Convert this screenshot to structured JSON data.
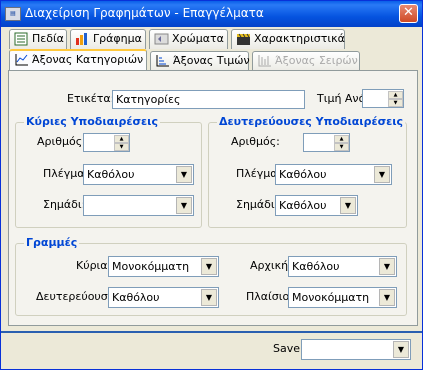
{
  "window": {
    "title": "Διαχείριση Γραφημάτων - Επαγγέλματα",
    "close_glyph": "✕"
  },
  "main_tabs": [
    {
      "label": "Πεδία",
      "icon": "fields-icon"
    },
    {
      "label": "Γράφημα",
      "icon": "bar-chart-icon"
    },
    {
      "label": "Χρώματα",
      "icon": "colors-icon"
    },
    {
      "label": "Χαρακτηριστικά",
      "icon": "clapperboard-icon"
    }
  ],
  "sub_tabs": [
    {
      "label": "Άξονας Κατηγοριών",
      "icon": "axis-icon",
      "selected": true
    },
    {
      "label": "Άξονας Τιμών",
      "icon": "axis-icon"
    },
    {
      "label": "Άξονας Σειρών",
      "icon": "axis-icon",
      "disabled": true
    }
  ],
  "caption": {
    "label": "Ετικέτα:",
    "value": "Κατηγορίες"
  },
  "value_step": {
    "label": "Τιμή Ανά:",
    "value": ""
  },
  "major": {
    "title": "Κύριες Υποδιαιρέσεις",
    "count_label": "Αριθμός:",
    "count_value": "",
    "grid_label": "Πλέγμα:",
    "grid_value": "Καθόλου",
    "mark_label": "Σημάδι:",
    "mark_value": ""
  },
  "minor": {
    "title": "Δευτερεύουσες Υποδιαιρέσεις",
    "count_label": "Αριθμός:",
    "count_value": "",
    "grid_label": "Πλέγμα:",
    "grid_value": "Καθόλου",
    "mark_label": "Σημάδι:",
    "mark_value": "Καθόλου"
  },
  "lines": {
    "title": "Γραμμές",
    "main_label": "Κύρια:",
    "main_value": "Μονοκόμματη",
    "initial_label": "Αρχική:",
    "initial_value": "Καθόλου",
    "secondary_label": "Δευτερεύουσα:",
    "secondary_value": "Καθόλου",
    "frame_label": "Πλαίσιο:",
    "frame_value": "Μονοκόμματη"
  },
  "footer": {
    "save_label": "Save",
    "save_value": ""
  },
  "colors": {
    "accent": "#0046d5",
    "separator": "#2a5fb0"
  }
}
